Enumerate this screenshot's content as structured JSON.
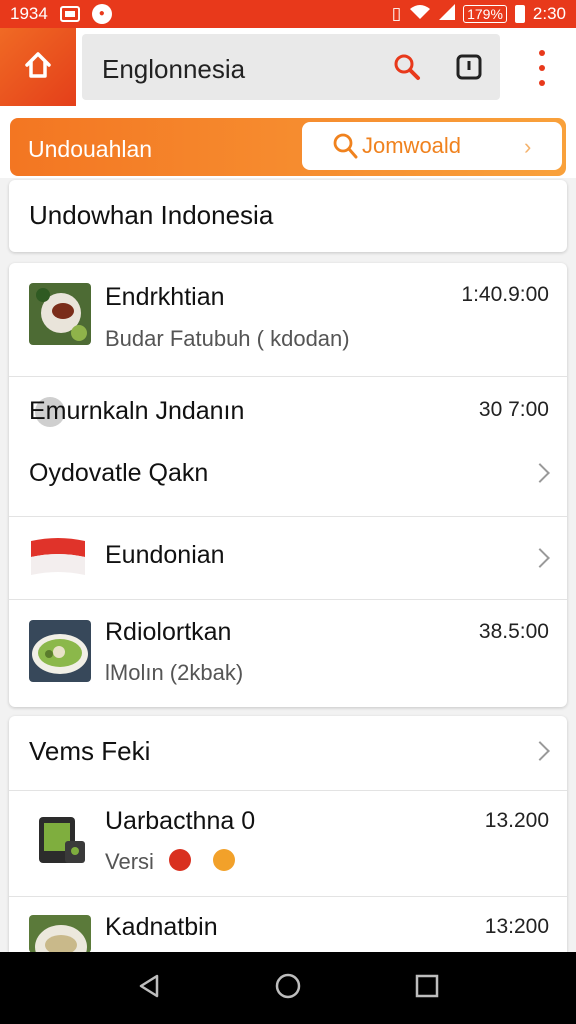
{
  "status_bar": {
    "time": "1934",
    "battery": "179%",
    "clock": "2:30"
  },
  "app_bar": {
    "search_value": "Englonnesia"
  },
  "orange_bar": {
    "label": "Undouahlan",
    "download_label": "Jomwoald"
  },
  "header_card": {
    "title": "Undowhan Indonesia"
  },
  "list_card": {
    "items": [
      {
        "title": "Endrkhtian",
        "subtitle": "Budar Fatubuh ( kdodan)",
        "value": "1:40.9:00"
      },
      {
        "title": "Emurnkaln Jndanın",
        "value": "30 7:00"
      },
      {
        "title": "Oydovatle Qakn"
      },
      {
        "title": "Eundonian"
      },
      {
        "title": "Rdiolortkan",
        "subtitle": "lMolın (2kbak)",
        "value": "38.5:00"
      }
    ]
  },
  "second_card": {
    "title": "Vems Feki",
    "items": [
      {
        "title": "Uarbacthna 0",
        "subtitle": "Versi",
        "value": "13.200"
      },
      {
        "title": "Kadnatbin",
        "value": "13:200"
      }
    ]
  },
  "colors": {
    "accent": "#e8391b",
    "orange": "#f37622",
    "flag_red": "#e0332a"
  }
}
